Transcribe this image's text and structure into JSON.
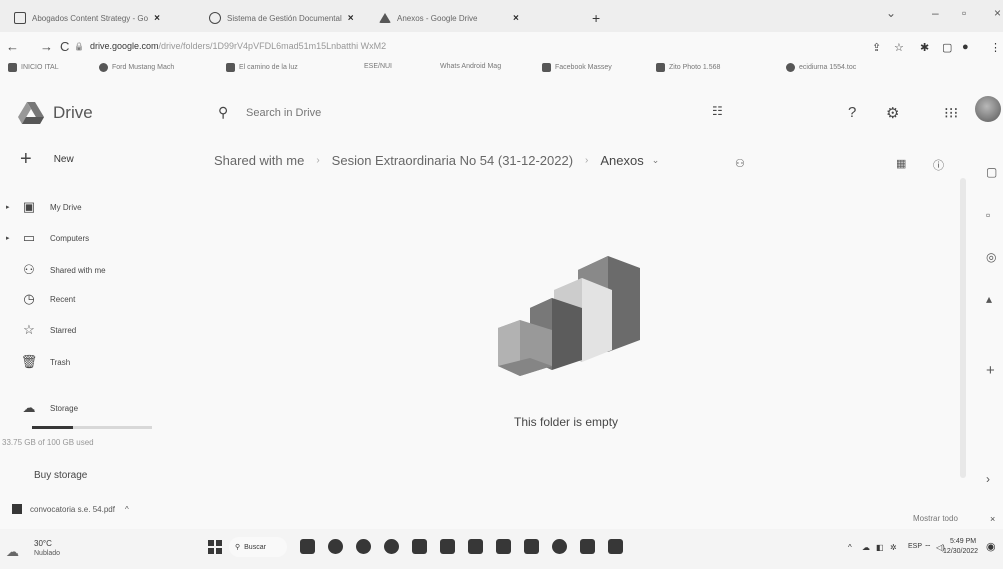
{
  "browser": {
    "tabs": [
      {
        "title": "Abogados Content Strategy - Go",
        "icon": "sheets-icon"
      },
      {
        "title": "Sistema de Gestión Documental",
        "icon": "shield-icon"
      },
      {
        "title": "Anexos - Google Drive",
        "icon": "drive-icon"
      }
    ],
    "new_tab": "+",
    "url": "drive.google.com",
    "url_path": "/drive/folders/1D99rV4pVFDL6mad51m15Lnbatthi WxM2",
    "bookmarks": [
      "INICIO ITAL",
      "Ford Mustang Mach",
      "El camino de la luz",
      "ESE/NUI",
      "Whats Android Mag",
      "Facebook Massey",
      "Zito Photo 1.568",
      "ecidiurna 1554.toc"
    ]
  },
  "drive": {
    "app_name": "Drive",
    "search_placeholder": "Search in Drive",
    "new_label": "New",
    "nav": [
      {
        "label": "My Drive",
        "icon": "my-drive-icon",
        "expandable": true
      },
      {
        "label": "Computers",
        "icon": "computer-icon",
        "expandable": true
      },
      {
        "label": "Shared with me",
        "icon": "shared-icon",
        "expandable": false
      },
      {
        "label": "Recent",
        "icon": "clock-icon",
        "expandable": false
      },
      {
        "label": "Starred",
        "icon": "star-icon",
        "expandable": false
      },
      {
        "label": "Trash",
        "icon": "trash-icon",
        "expandable": false
      },
      {
        "label": "Storage",
        "icon": "cloud-icon",
        "expandable": false
      }
    ],
    "storage_used": "33.75 GB of 100 GB used",
    "storage_fraction": 0.3375,
    "buy_storage": "Buy storage",
    "breadcrumb": [
      "Shared with me",
      "Sesion Extraordinaria No 54 (31-12-2022)",
      "Anexos"
    ],
    "empty_message": "This folder is empty"
  },
  "download": {
    "filename": "convocatoria s.e. 54.pdf",
    "show_all": "Mostrar todo"
  },
  "taskbar": {
    "temperature": "30°C",
    "weather": "Nublado",
    "search": "Buscar",
    "language": "ESP",
    "time": "5:49 PM",
    "date": "12/30/2022"
  }
}
